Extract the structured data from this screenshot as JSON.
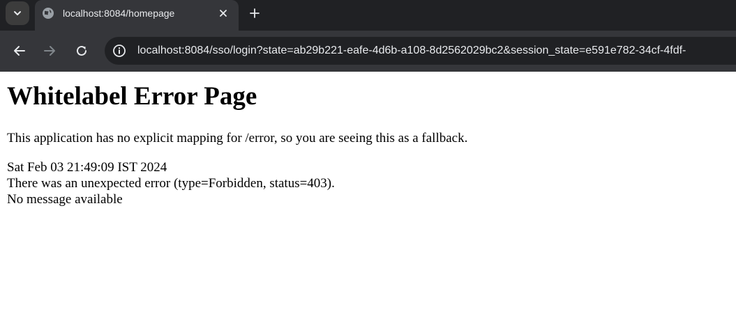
{
  "browser": {
    "tab": {
      "title": "localhost:8084/homepage"
    },
    "address_bar": {
      "url": "localhost:8084/sso/login?state=ab29b221-eafe-4d6b-a108-8d2562029bc2&session_state=e591e782-34cf-4fdf-"
    },
    "icons": {
      "tab_search": "chevron-down-icon",
      "favicon": "globe-icon",
      "close": "close-icon",
      "new_tab": "plus-icon",
      "back": "arrow-left-icon",
      "forward": "arrow-right-icon",
      "reload": "reload-icon",
      "site_info": "info-icon"
    }
  },
  "page": {
    "heading": "Whitelabel Error Page",
    "description": "This application has no explicit mapping for /error, so you are seeing this as a fallback.",
    "timestamp": "Sat Feb 03 21:49:09 IST 2024",
    "error_line": "There was an unexpected error (type=Forbidden, status=403).",
    "message": "No message available"
  },
  "colors": {
    "tabbar_bg": "#202124",
    "toolbar_bg": "#35363a",
    "omnibox_bg": "#202124",
    "text_light": "#e8eaed",
    "page_bg": "#ffffff"
  }
}
